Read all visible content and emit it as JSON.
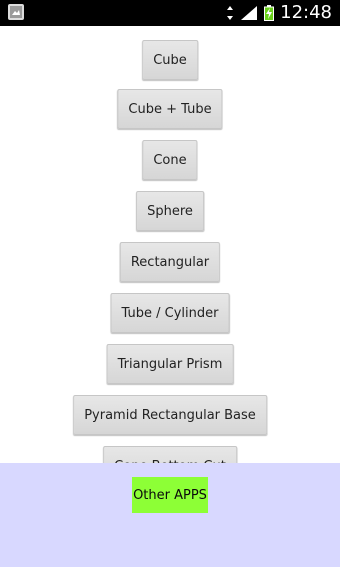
{
  "status_bar": {
    "time": "12:48",
    "left_icon": "screenshot-icon",
    "icons": [
      "signal-icon",
      "battery-charging-icon"
    ]
  },
  "buttons": [
    {
      "label": "Cube"
    },
    {
      "label": "Cube + Tube"
    },
    {
      "label": "Cone"
    },
    {
      "label": "Sphere"
    },
    {
      "label": "Rectangular"
    },
    {
      "label": "Tube / Cylinder"
    },
    {
      "label": "Triangular Prism"
    },
    {
      "label": "Pyramid Rectangular Base"
    }
  ],
  "partially_hidden_button": {
    "label": "Cone Bottom Cut"
  },
  "overlay": {
    "button_label": "Other APPS",
    "background_color": "#d8d8ff",
    "button_color": "#8dff36"
  }
}
